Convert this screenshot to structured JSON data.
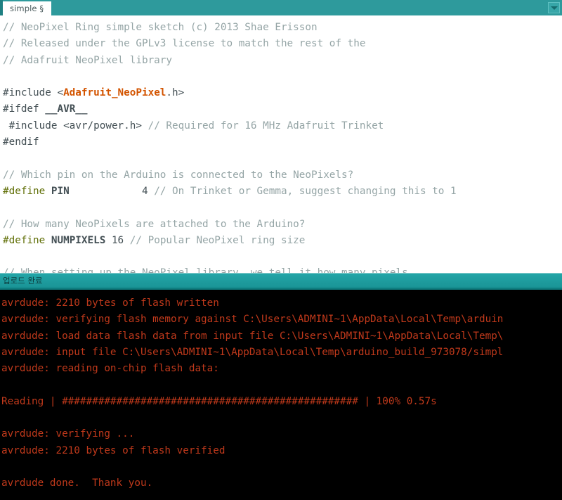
{
  "window": {
    "tab": {
      "label": "simple §",
      "menu_icon": "chevron-down-icon"
    },
    "accent_color": "#2e9a9c",
    "console_bg": "#000000",
    "console_text_color": "#c0391b"
  },
  "editor": {
    "lines": [
      {
        "id": "l1",
        "segments": [
          {
            "cls": "cmt",
            "text": "// NeoPixel Ring simple sketch (c) 2013 Shae Erisson"
          }
        ]
      },
      {
        "id": "l2",
        "segments": [
          {
            "cls": "cmt",
            "text": "// Released under the GPLv3 license to match the rest of the"
          }
        ]
      },
      {
        "id": "l3",
        "segments": [
          {
            "cls": "cmt",
            "text": "// Adafruit NeoPixel library"
          }
        ]
      },
      {
        "id": "l4",
        "segments": [
          {
            "cls": "plain",
            "text": ""
          }
        ]
      },
      {
        "id": "l5",
        "segments": [
          {
            "cls": "preh",
            "text": "#include "
          },
          {
            "cls": "plain",
            "text": "<"
          },
          {
            "cls": "lib",
            "text": "Adafruit_NeoPixel"
          },
          {
            "cls": "plain",
            "text": ".h>"
          }
        ]
      },
      {
        "id": "l6",
        "segments": [
          {
            "cls": "preh",
            "text": "#ifdef "
          },
          {
            "cls": "def",
            "text": "__AVR__"
          }
        ]
      },
      {
        "id": "l7",
        "segments": [
          {
            "cls": "preh",
            "text": " #include "
          },
          {
            "cls": "plain",
            "text": "<avr/power.h> "
          },
          {
            "cls": "cmt",
            "text": "// Required for 16 MHz Adafruit Trinket"
          }
        ]
      },
      {
        "id": "l8",
        "segments": [
          {
            "cls": "preh",
            "text": "#endif"
          }
        ]
      },
      {
        "id": "l9",
        "segments": [
          {
            "cls": "plain",
            "text": ""
          }
        ]
      },
      {
        "id": "l10",
        "segments": [
          {
            "cls": "cmt",
            "text": "// Which pin on the Arduino is connected to the NeoPixels?"
          }
        ]
      },
      {
        "id": "l11",
        "segments": [
          {
            "cls": "pre",
            "text": "#define "
          },
          {
            "cls": "def",
            "text": "PIN"
          },
          {
            "cls": "plain",
            "text": "            4 "
          },
          {
            "cls": "cmt",
            "text": "// On Trinket or Gemma, suggest changing this to 1"
          }
        ]
      },
      {
        "id": "l12",
        "segments": [
          {
            "cls": "plain",
            "text": ""
          }
        ]
      },
      {
        "id": "l13",
        "segments": [
          {
            "cls": "cmt",
            "text": "// How many NeoPixels are attached to the Arduino?"
          }
        ]
      },
      {
        "id": "l14",
        "segments": [
          {
            "cls": "pre",
            "text": "#define "
          },
          {
            "cls": "def",
            "text": "NUMPIXELS"
          },
          {
            "cls": "plain",
            "text": " 16 "
          },
          {
            "cls": "cmt",
            "text": "// Popular NeoPixel ring size"
          }
        ]
      },
      {
        "id": "l15",
        "segments": [
          {
            "cls": "plain",
            "text": ""
          }
        ]
      },
      {
        "id": "l16",
        "segments": [
          {
            "cls": "cmt",
            "text": "// When setting up the NeoPixel library, we tell it how many pixels"
          }
        ]
      }
    ]
  },
  "console": {
    "status_label": "업로드 완료",
    "lines": [
      "avrdude: 2210 bytes of flash written",
      "avrdude: verifying flash memory against C:\\Users\\ADMINI~1\\AppData\\Local\\Temp\\arduin",
      "avrdude: load data flash data from input file C:\\Users\\ADMINI~1\\AppData\\Local\\Temp\\",
      "avrdude: input file C:\\Users\\ADMINI~1\\AppData\\Local\\Temp\\arduino_build_973078/simpl",
      "avrdude: reading on-chip flash data:",
      "",
      "Reading | ################################################# | 100% 0.57s",
      "",
      "avrdude: verifying ...",
      "avrdude: 2210 bytes of flash verified",
      "",
      "avrdude done.  Thank you."
    ]
  }
}
